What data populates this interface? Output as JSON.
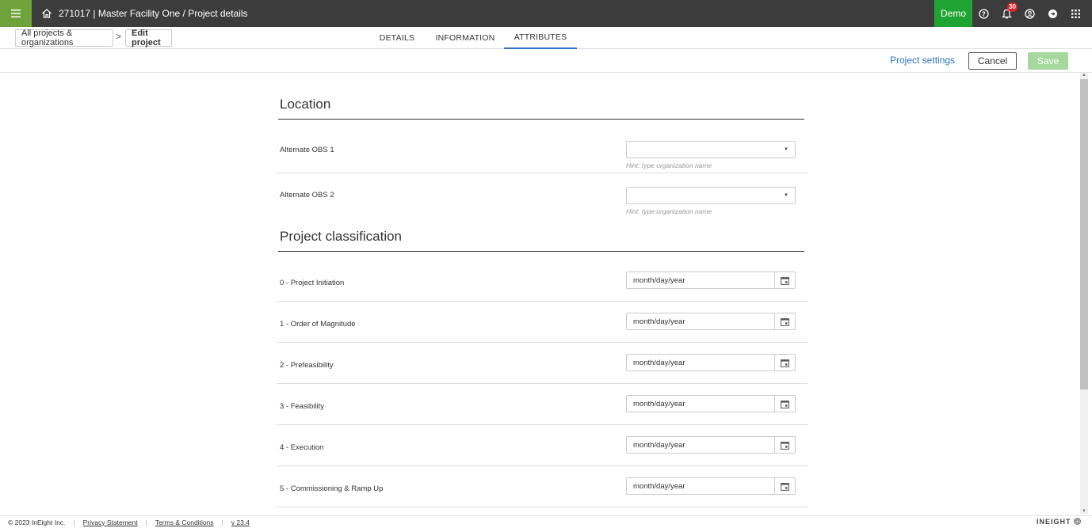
{
  "topbar": {
    "title": "271017 | Master Facility One  /  Project details",
    "demo_label": "Demo",
    "notification_count": "30"
  },
  "breadcrumb": {
    "item1": "All projects & organizations",
    "separator": ">",
    "item2": "Edit project"
  },
  "tabs": [
    "DETAILS",
    "INFORMATION",
    "ATTRIBUTES"
  ],
  "actions": {
    "project_settings": "Project settings",
    "cancel": "Cancel",
    "save": "Save"
  },
  "location": {
    "title": "Location",
    "fields": [
      {
        "label": "Alternate OBS 1",
        "value": "",
        "hint": "Hint: type organization name"
      },
      {
        "label": "Alternate OBS 2",
        "value": "",
        "hint": "Hint: type organization name"
      }
    ]
  },
  "classification": {
    "title": "Project classification",
    "fields": [
      {
        "label": "0 - Project Initiation",
        "placeholder": "month/day/year"
      },
      {
        "label": "1 - Order of Magnitude",
        "placeholder": "month/day/year"
      },
      {
        "label": "2 - Prefeasibility",
        "placeholder": "month/day/year"
      },
      {
        "label": "3 - Feasibility",
        "placeholder": "month/day/year"
      },
      {
        "label": "4 - Execution",
        "placeholder": "month/day/year"
      },
      {
        "label": "5 - Commissioning & Ramp Up",
        "placeholder": "month/day/year"
      }
    ]
  },
  "footer": {
    "copyright": "© 2023 InEight Inc.",
    "privacy": "Privacy Statement",
    "terms": "Terms & Conditions",
    "version": "v 23.4",
    "brand": "INEIGHT"
  },
  "colors": {
    "brand_green": "#6fa23a",
    "demo_green": "#1fa433",
    "accent_blue": "#2b73c5",
    "save_disabled": "#a4d89c"
  }
}
